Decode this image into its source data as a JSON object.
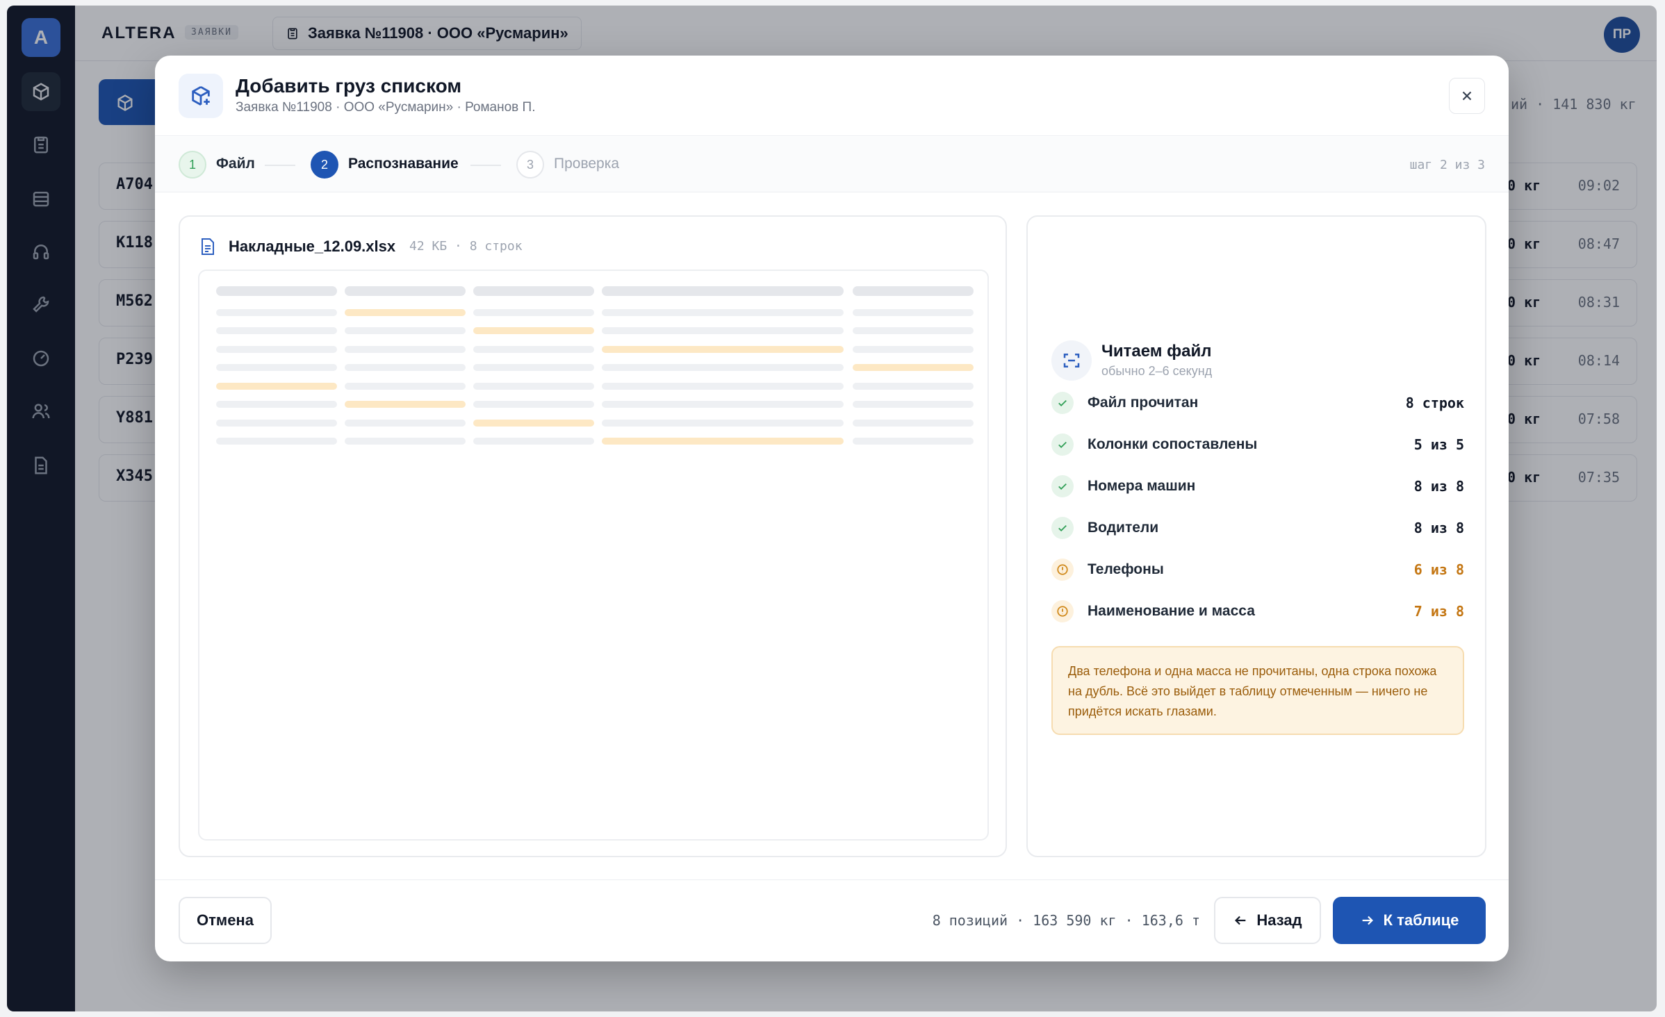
{
  "app": {
    "logo_letter": "A",
    "brand": "ALTERA",
    "brand_tag": "ЗАЯВКИ",
    "breadcrumb": "Заявка №11908 · ООО «Русмарин»",
    "avatar_initials": "ПР",
    "summary_fragment": "ий · 141 830 кг",
    "rows": [
      {
        "plate": "A704",
        "kg": "0 кг",
        "time": "09:02"
      },
      {
        "plate": "K118",
        "kg": "0 кг",
        "time": "08:47"
      },
      {
        "plate": "M562",
        "kg": "0 кг",
        "time": "08:31"
      },
      {
        "plate": "P239",
        "kg": "0 кг",
        "time": "08:14"
      },
      {
        "plate": "Y881",
        "kg": "0 кг",
        "time": "07:58"
      },
      {
        "plate": "X345",
        "kg": "0 кг",
        "time": "07:35"
      }
    ],
    "rail_icons": [
      "cube-icon",
      "clipboard-icon",
      "inbox-icon",
      "headset-icon",
      "wrench-icon",
      "gauge-icon",
      "users-icon",
      "document-icon"
    ]
  },
  "modal": {
    "title": "Добавить груз списком",
    "subtitle": "Заявка №11908 · ООО «Русмарин» · Романов П.",
    "steps": [
      {
        "num": "1",
        "label": "Файл",
        "state": "done"
      },
      {
        "num": "2",
        "label": "Распознавание",
        "state": "active"
      },
      {
        "num": "3",
        "label": "Проверка",
        "state": "pending"
      }
    ],
    "step_counter": "шаг 2 из 3",
    "file": {
      "name": "Накладные_12.09.xlsx",
      "meta": "42 КБ · 8 строк"
    },
    "recognition": {
      "title": "Читаем файл",
      "subtitle": "обычно 2–6 секунд",
      "checks": [
        {
          "label": "Файл прочитан",
          "value": "8 строк",
          "status": "ok"
        },
        {
          "label": "Колонки сопоставлены",
          "value": "5 из 5",
          "status": "ok"
        },
        {
          "label": "Номера машин",
          "value": "8 из 8",
          "status": "ok"
        },
        {
          "label": "Водители",
          "value": "8 из 8",
          "status": "ok"
        },
        {
          "label": "Телефоны",
          "value": "6 из 8",
          "status": "warn"
        },
        {
          "label": "Наименование и масса",
          "value": "7 из 8",
          "status": "warn"
        }
      ],
      "note": "Два телефона и одна масса не прочитаны, одна строка похожа на дубль. Всё это выйдет в таблицу отмеченным — ничего не придётся искать глазами."
    },
    "footer": {
      "cancel": "Отмена",
      "totals": "8 позиций · 163 590 кг · 163,6 т",
      "back": "Назад",
      "next": "К таблице"
    }
  },
  "colors": {
    "accent": "#1e55b3",
    "ok": "#2f9e55",
    "warn": "#d0891b",
    "highlight": "#fde8c4"
  }
}
